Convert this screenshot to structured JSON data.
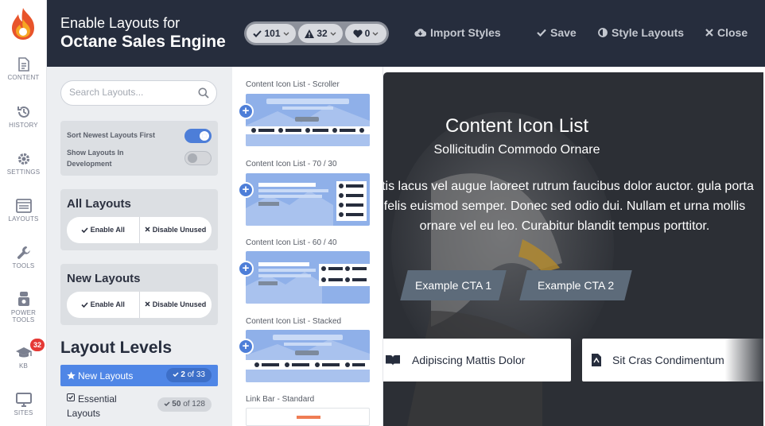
{
  "rail": {
    "items": [
      {
        "label": "CONTENT"
      },
      {
        "label": "HISTORY"
      },
      {
        "label": "SETTINGS"
      },
      {
        "label": "LAYOUTS"
      },
      {
        "label": "TOOLS"
      },
      {
        "label": "POWER",
        "label2": "TOOLS"
      },
      {
        "label": "KB",
        "badge": "32"
      },
      {
        "label": "SITES"
      }
    ]
  },
  "header": {
    "line1": "Enable Layouts for",
    "line2": "Octane Sales Engine",
    "counts": {
      "approved": "101",
      "warnings": "32",
      "favorites": "0"
    },
    "import_label": "Import Styles",
    "save_label": "Save",
    "style_label": "Style Layouts",
    "close_label": "Close"
  },
  "panel": {
    "search_placeholder": "Search Layouts...",
    "toggles": [
      {
        "label": "Sort Newest Layouts First",
        "on": true
      },
      {
        "label": "Show Layouts In Development",
        "on": false
      }
    ],
    "all_layouts": {
      "title": "All Layouts",
      "enable": "Enable All",
      "disable": "Disable Unused"
    },
    "new_layouts": {
      "title": "New Layouts",
      "enable": "Enable All",
      "disable": "Disable Unused"
    },
    "levels_title": "Layout Levels",
    "levels": [
      {
        "label": "New Layouts",
        "count": "2",
        "of": "of 33"
      },
      {
        "label": "Essential Layouts",
        "count": "50",
        "of": "of 128"
      }
    ]
  },
  "layouts": [
    {
      "label": "Content Icon List - Scroller"
    },
    {
      "label": "Content Icon List - 70 / 30"
    },
    {
      "label": "Content Icon List - 60 / 40"
    },
    {
      "label": "Content Icon List - Stacked"
    },
    {
      "label": "Link Bar - Standard"
    }
  ],
  "preview": {
    "title": "Content Icon List",
    "subtitle": "Sollicitudin Commodo Ornare",
    "body": "ittis lacus vel augue laoreet rutrum faucibus dolor auctor. gula porta felis euismod semper. Donec sed odio dui. Nullam et urna mollis ornare vel eu leo. Curabitur blandit tempus porttitor.",
    "cta1": "Example CTA 1",
    "cta2": "Example CTA 2",
    "item1": "Adipiscing Mattis Dolor",
    "item2": "Sit Cras Condimentum"
  },
  "colors": {
    "header_bg": "#262d3d",
    "accent": "#4f86e6",
    "thumb": "#8fb0e9",
    "badge": "#e53935"
  }
}
